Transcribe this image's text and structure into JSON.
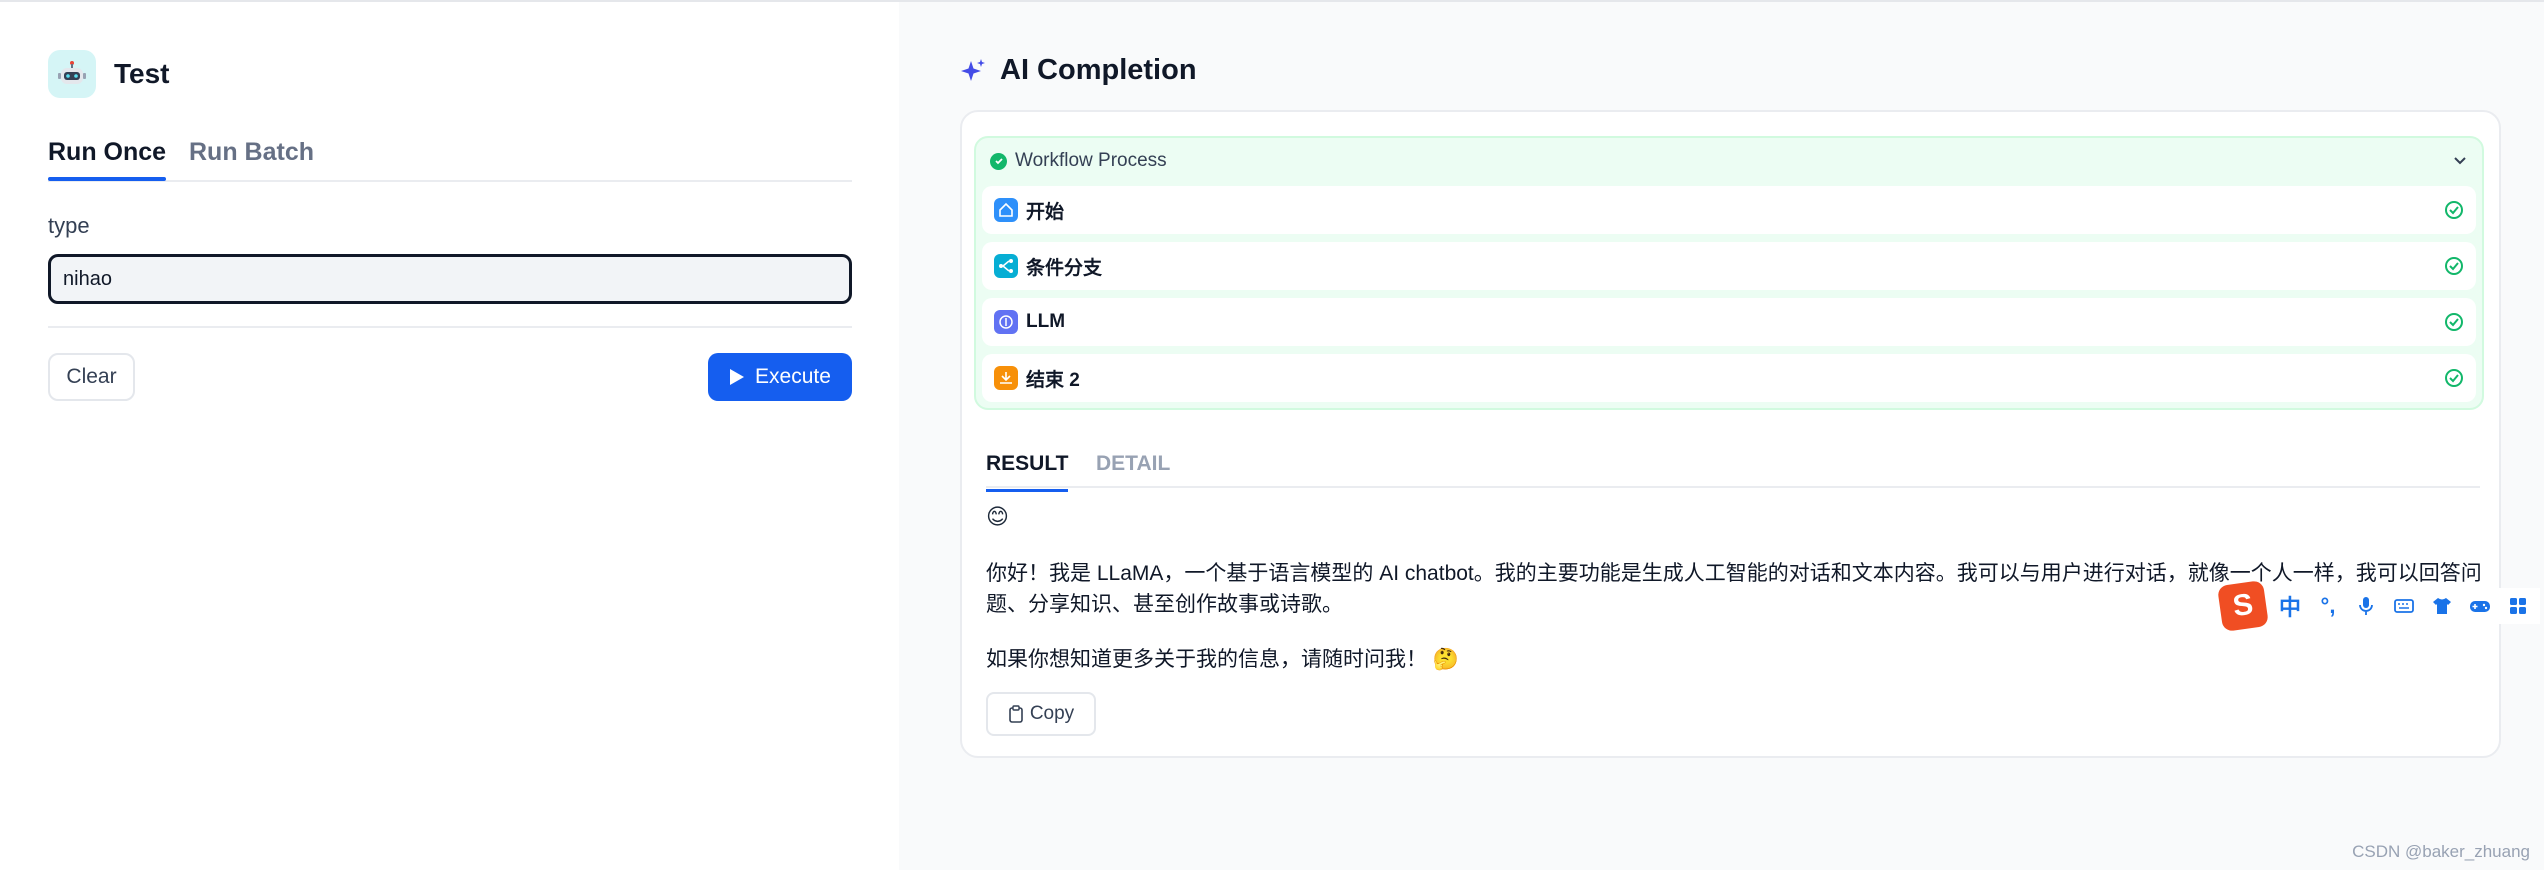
{
  "app": {
    "title": "Test"
  },
  "tabs": [
    "Run Once",
    "Run Batch"
  ],
  "form": {
    "field_label": "type",
    "field_value": "nihao"
  },
  "buttons": {
    "clear": "Clear",
    "execute": "Execute",
    "copy": "Copy"
  },
  "result": {
    "title": "AI Completion",
    "workflow": {
      "header": "Workflow Process",
      "status": "success",
      "nodes": [
        {
          "label": "开始",
          "icon": "home-icon",
          "color": "#2e90fa"
        },
        {
          "label": "条件分支",
          "icon": "branch-icon",
          "color": "#06aed4"
        },
        {
          "label": "LLM",
          "icon": "llm-icon",
          "color": "#6172f3"
        },
        {
          "label": "结束 2",
          "icon": "end-icon",
          "color": "#f79009"
        }
      ]
    },
    "tabs": [
      "RESULT",
      "DETAIL"
    ],
    "emoji": "😊",
    "paragraph1": "你好！我是 LLaMA，一个基于语言模型的 AI chatbot。我的主要功能是生成人工智能的对话和文本内容。我可以与用户进行对话，就像一个人一样，我可以回答问题、分享知识、甚至创作故事或诗歌。",
    "paragraph2": "如果你想知道更多关于我的信息，请随时问我！ 🤔"
  },
  "ime": {
    "items": [
      "中",
      "°,",
      "mic-icon",
      "keyboard-icon",
      "shirt-icon",
      "gamepad-icon",
      "apps-icon"
    ]
  },
  "watermark": "CSDN @baker_zhuang",
  "colors": {
    "accent": "#155eef",
    "success": "#12b76a"
  }
}
